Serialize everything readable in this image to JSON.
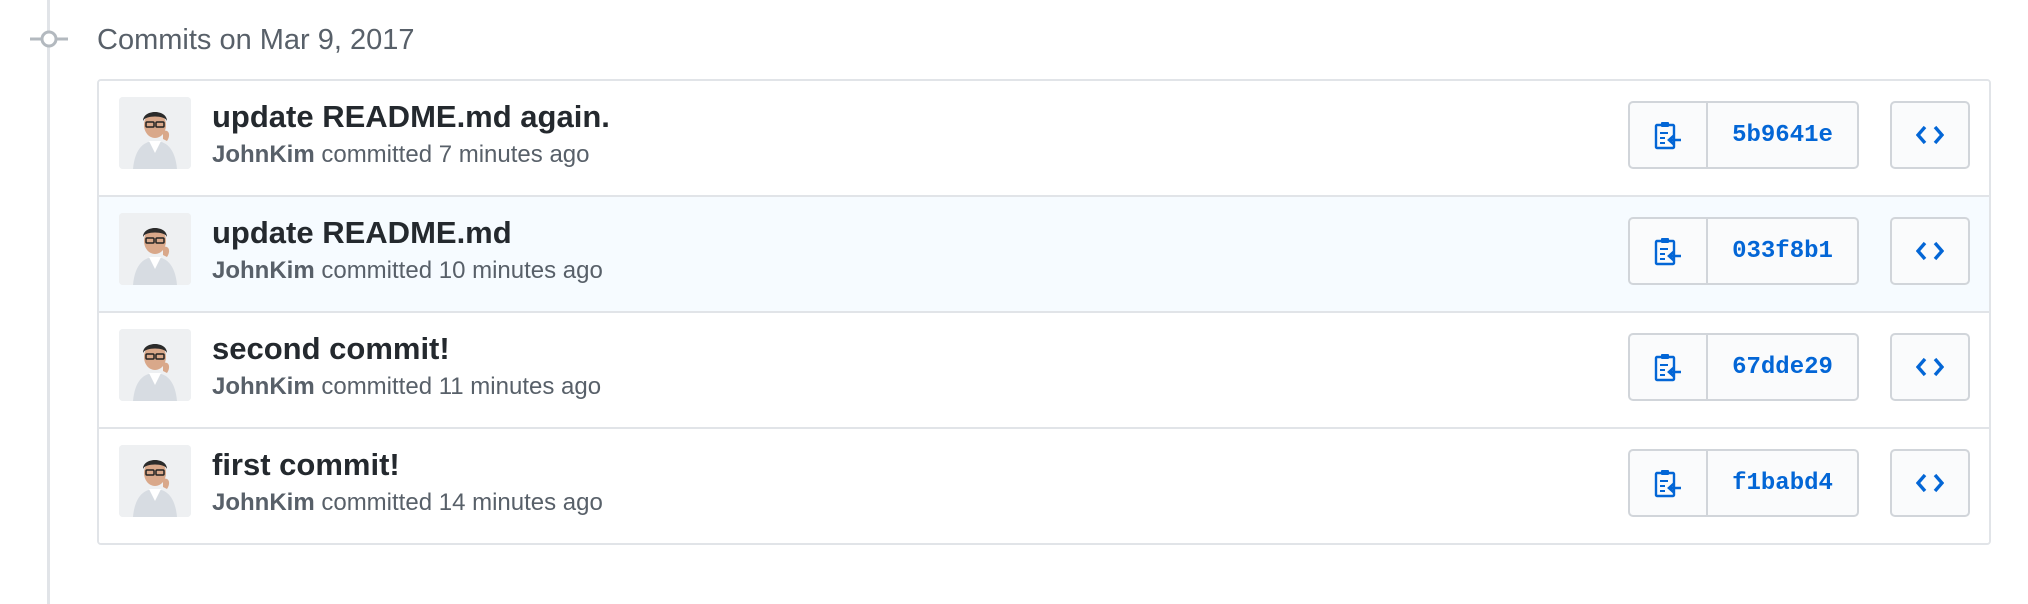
{
  "group": {
    "title": "Commits on Mar 9, 2017"
  },
  "commits": [
    {
      "title": "update README.md again.",
      "author": "JohnKim",
      "action": "committed",
      "time": "7 minutes ago",
      "sha": "5b9641e"
    },
    {
      "title": "update README.md",
      "author": "JohnKim",
      "action": "committed",
      "time": "10 minutes ago",
      "sha": "033f8b1"
    },
    {
      "title": "second commit!",
      "author": "JohnKim",
      "action": "committed",
      "time": "11 minutes ago",
      "sha": "67dde29"
    },
    {
      "title": "first commit!",
      "author": "JohnKim",
      "action": "committed",
      "time": "14 minutes ago",
      "sha": "f1babd4"
    }
  ],
  "icons": {
    "timeline": "git-commit-icon",
    "copy": "clippy-icon",
    "browse": "code-icon"
  },
  "colors": {
    "link": "#0366d6",
    "highlight_row": "#f6fbff",
    "border": "#e1e4e8"
  }
}
